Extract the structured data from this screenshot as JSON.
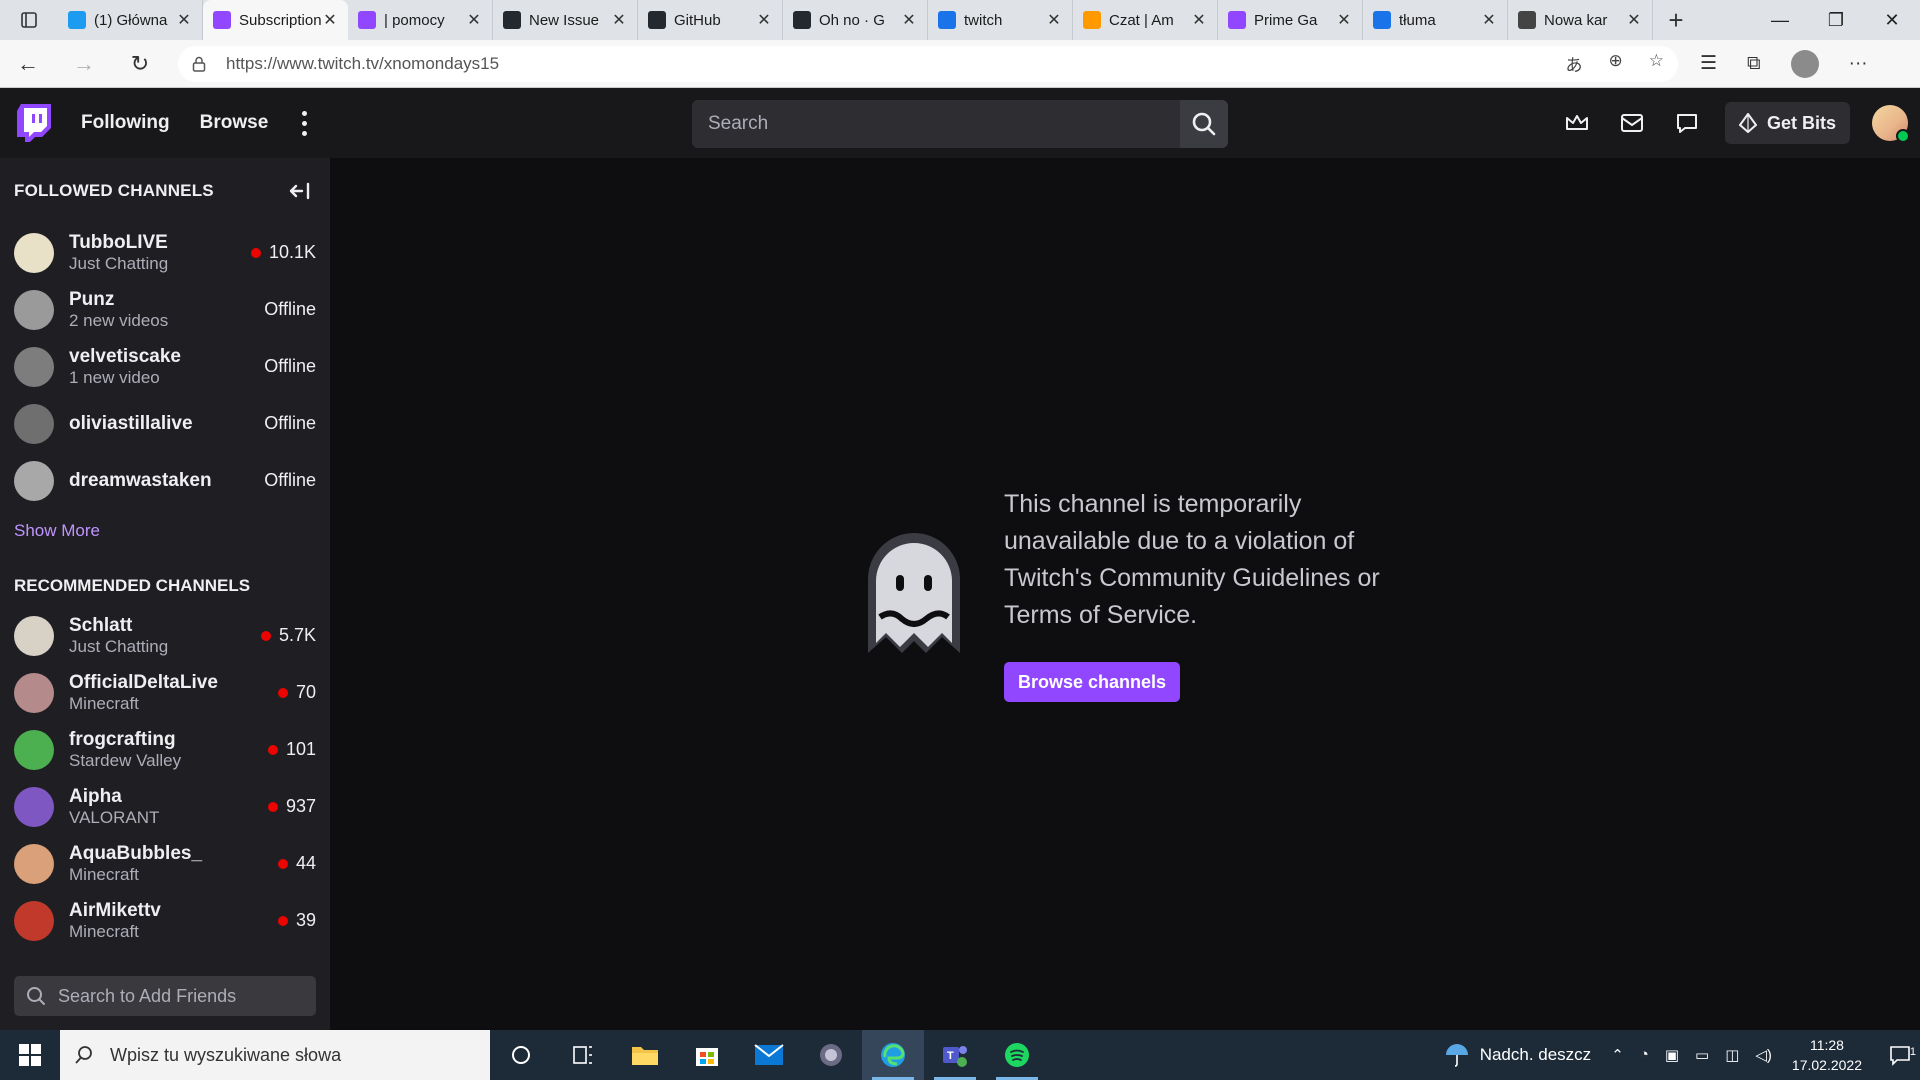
{
  "browser": {
    "tabs": [
      {
        "label": "(1) Główna",
        "icon": "twitter-icon",
        "color": "#1d9bf0"
      },
      {
        "label": "Subscriptions",
        "icon": "twitch-icon",
        "color": "#9147ff",
        "active": true
      },
      {
        "label": "| pomocy",
        "icon": "twitch-icon",
        "color": "#9147ff"
      },
      {
        "label": "New Issue",
        "icon": "github-icon",
        "color": "#24292f"
      },
      {
        "label": "GitHub",
        "icon": "github-icon",
        "color": "#24292f"
      },
      {
        "label": "Oh no · G",
        "icon": "github-icon",
        "color": "#24292f"
      },
      {
        "label": "twitch",
        "icon": "bing-icon",
        "color": "#1a73e8"
      },
      {
        "label": "Czat | Am",
        "icon": "amazon-icon",
        "color": "#ff9900"
      },
      {
        "label": "Prime Ga",
        "icon": "prime-gaming-icon",
        "color": "#9146ff"
      },
      {
        "label": "tłuma",
        "icon": "bing-icon",
        "color": "#1a73e8"
      },
      {
        "label": "Nowa kar",
        "icon": "new-tab-icon",
        "color": "#444444"
      }
    ],
    "url": "https://www.twitch.tv/xnomondays15"
  },
  "topnav": {
    "following": "Following",
    "browse": "Browse",
    "search_placeholder": "Search",
    "get_bits": "Get Bits"
  },
  "sidebar": {
    "followed_title": "FOLLOWED CHANNELS",
    "followed": [
      {
        "name": "TubboLIVE",
        "sub": "Just Chatting",
        "status": "10.1K",
        "live": true,
        "avatar": "#e9e0c8"
      },
      {
        "name": "Punz",
        "sub": "2 new videos",
        "status": "Offline",
        "live": false,
        "avatar": "#9a9a9a"
      },
      {
        "name": "velvetiscake",
        "sub": "1 new video",
        "status": "Offline",
        "live": false,
        "avatar": "#7d7d7d"
      },
      {
        "name": "oliviastillalive",
        "sub": "",
        "status": "Offline",
        "live": false,
        "avatar": "#6f6f6f"
      },
      {
        "name": "dreamwastaken",
        "sub": "",
        "status": "Offline",
        "live": false,
        "avatar": "#a8a8a8"
      }
    ],
    "show_more": "Show More",
    "recommended_title": "RECOMMENDED CHANNELS",
    "recommended": [
      {
        "name": "Schlatt",
        "sub": "Just Chatting",
        "status": "5.7K",
        "avatar": "#d8d2c6"
      },
      {
        "name": "OfficialDeltaLive",
        "sub": "Minecraft",
        "status": "70",
        "avatar": "#b58a8a"
      },
      {
        "name": "frogcrafting",
        "sub": "Stardew Valley",
        "status": "101",
        "avatar": "#4caf50"
      },
      {
        "name": "Aipha",
        "sub": "VALORANT",
        "status": "937",
        "avatar": "#7e57c2"
      },
      {
        "name": "AquaBubbles_",
        "sub": "Minecraft",
        "status": "44",
        "avatar": "#d9a07a"
      },
      {
        "name": "AirMikettv",
        "sub": "Minecraft",
        "status": "39",
        "avatar": "#c0392b"
      }
    ],
    "friend_search": "Search to Add Friends"
  },
  "main": {
    "message": "This channel is temporarily unavailable due to a violation of Twitch's Community Guidelines or Terms of Service.",
    "button": "Browse channels"
  },
  "taskbar": {
    "search": "Wpisz tu wyszukiwane słowa",
    "weather": "Nadch. deszcz",
    "time": "11:28",
    "date": "17.02.2022",
    "notifications": "1"
  },
  "colors": {
    "accent": "#9147ff",
    "live": "#eb0400",
    "link": "#bf94ff"
  }
}
